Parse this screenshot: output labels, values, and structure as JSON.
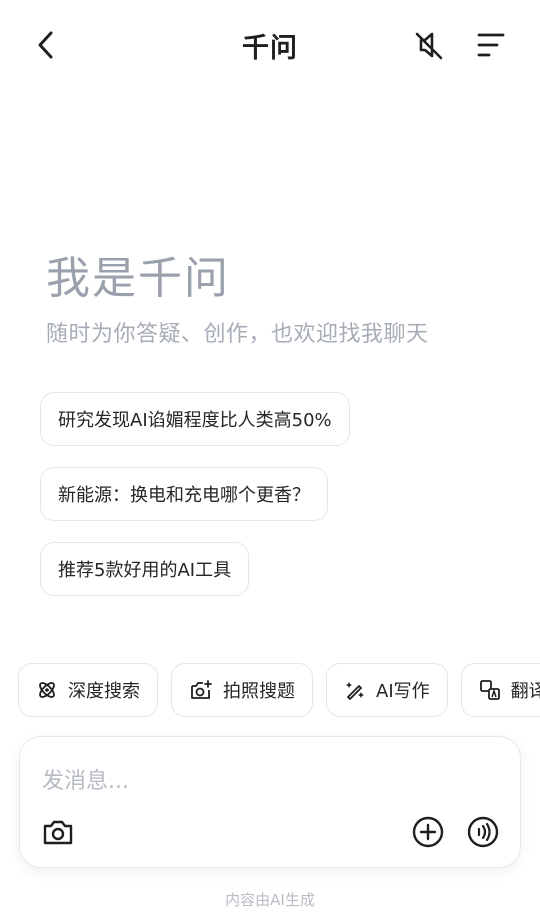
{
  "header": {
    "title": "千问",
    "back_icon": "chevron-left-icon",
    "mute_icon": "speaker-muted-icon",
    "menu_icon": "menu-icon"
  },
  "welcome": {
    "title": "我是千问",
    "subtitle": "随时为你答疑、创作，也欢迎找我聊天"
  },
  "suggestions": [
    {
      "label": "研究发现AI谄媚程度比人类高50%"
    },
    {
      "label": "新能源：换电和充电哪个更香？"
    },
    {
      "label": "推荐5款好用的AI工具"
    }
  ],
  "tools": [
    {
      "label": "深度搜索",
      "icon": "deep-search-icon"
    },
    {
      "label": "拍照搜题",
      "icon": "photo-search-icon"
    },
    {
      "label": "AI写作",
      "icon": "magic-pen-icon"
    },
    {
      "label": "翻译",
      "icon": "translate-icon"
    }
  ],
  "input": {
    "placeholder": "发消息...",
    "camera_icon": "camera-icon",
    "add_icon": "plus-circle-icon",
    "voice_icon": "voice-icon"
  },
  "footer": {
    "note": "内容由AI生成"
  }
}
